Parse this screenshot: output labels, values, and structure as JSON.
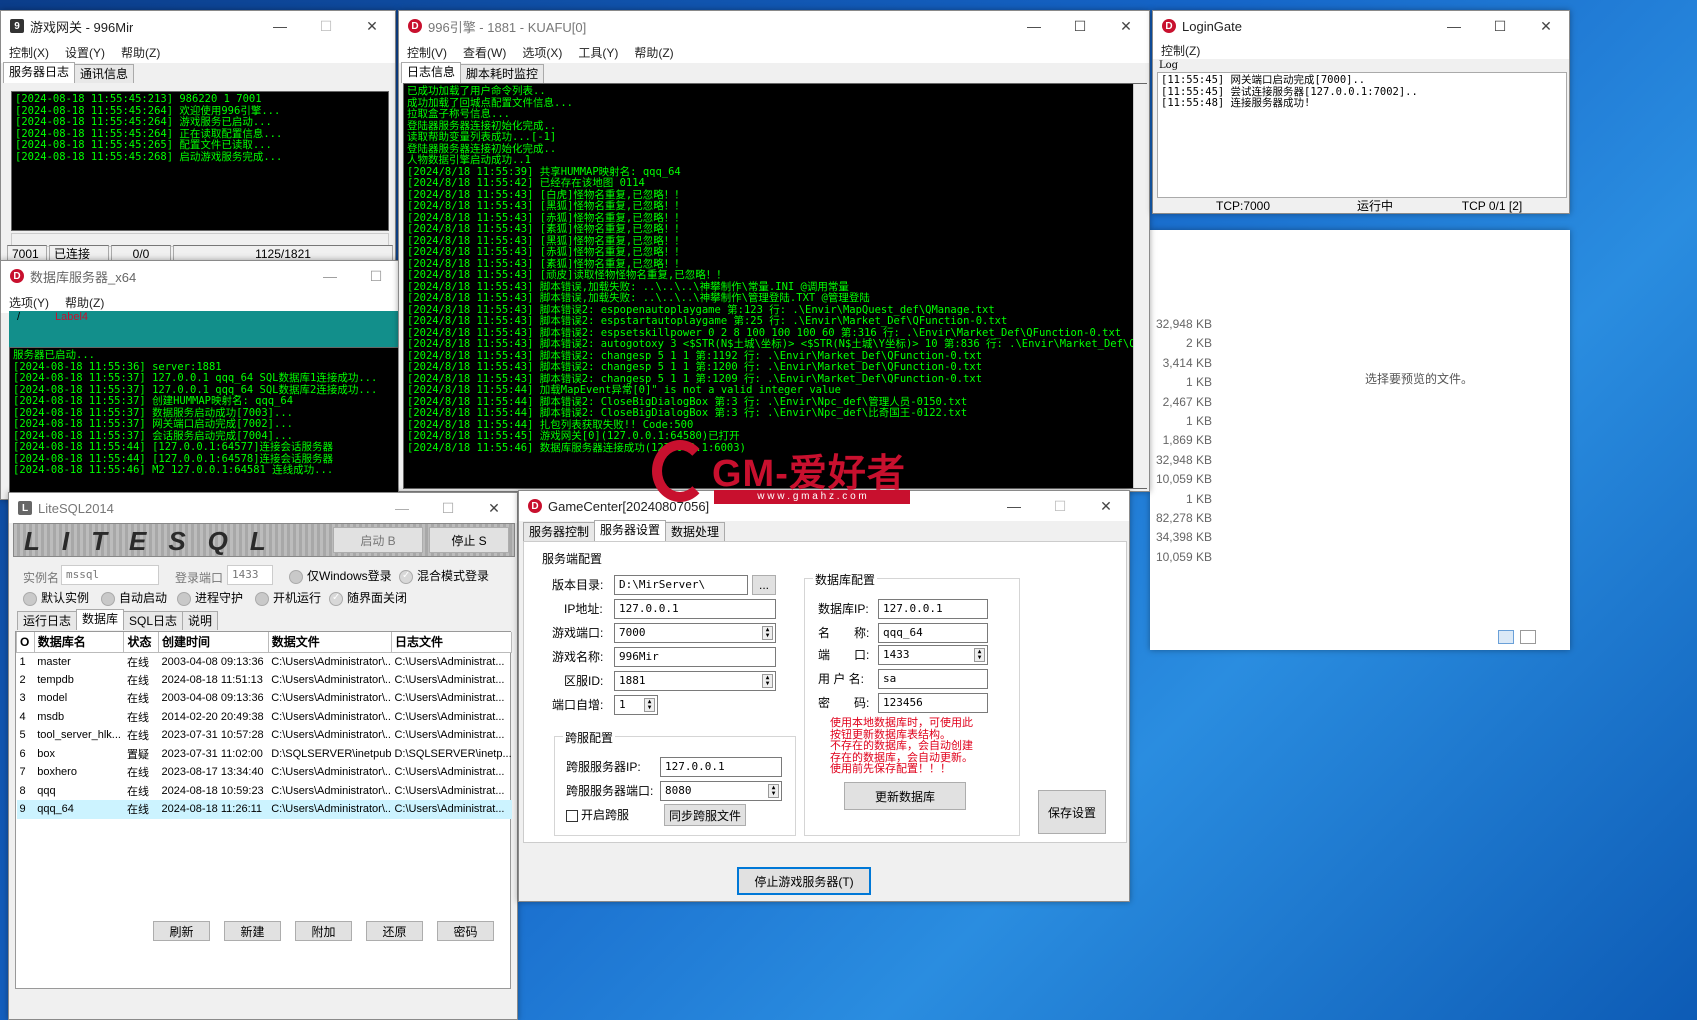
{
  "gateway": {
    "title": "游戏网关 - 996Mir",
    "menu": [
      "控制(X)",
      "设置(Y)",
      "帮助(Z)"
    ],
    "tabs": [
      "服务器日志",
      "通讯信息"
    ],
    "log": [
      "[2024-08-18 11:55:45:213] 986220 1 7001",
      "[2024-08-18 11:55:45:264] 欢迎使用996引擎...",
      "[2024-08-18 11:55:45:264] 游戏服务已启动...",
      "[2024-08-18 11:55:45:264] 正在读取配置信息...",
      "[2024-08-18 11:55:45:265] 配置文件已读取...",
      "[2024-08-18 11:55:45:268] 启动游戏服务完成..."
    ],
    "status": [
      "7001",
      "已连接",
      "0/0",
      "1125/1821"
    ]
  },
  "engine": {
    "title": "996引擎 - 1881 - KUAFU[0]",
    "menu": [
      "控制(V)",
      "查看(W)",
      "选项(X)",
      "工具(Y)",
      "帮助(Z)"
    ],
    "tabs": [
      "日志信息",
      "脚本耗时监控"
    ],
    "log": [
      "已成功加载了用户命令列表..",
      "成功加载了回城点配置文件信息...",
      "拉取盒子称号信息...",
      "登陆器服务器连接初始化完成..",
      "读取帮助变量列表成功...[-1]",
      "登陆器服务器连接初始化完成..",
      "人物数据引擎启动成功..1",
      "[2024/8/18 11:55:39] 共享HUMMAP映射名: qqq_64",
      "[2024/8/18 11:55:42] 已经存在该地图 0114",
      "[2024/8/18 11:55:43] [白虎]怪物名重复,已忽略！！",
      "[2024/8/18 11:55:43] [黑狐]怪物名重复,已忽略！！",
      "[2024/8/18 11:55:43] [赤狐]怪物名重复,已忽略！！",
      "[2024/8/18 11:55:43] [素狐]怪物名重复,已忽略！！",
      "[2024/8/18 11:55:43] [黑狐]怪物名重复,已忽略！！",
      "[2024/8/18 11:55:43] [赤狐]怪物名重复,已忽略！！",
      "[2024/8/18 11:55:43] [素狐]怪物名重复,已忽略！！",
      "[2024/8/18 11:55:43] [顽皮]读取怪物怪物名重复,已忽略！！",
      "[2024/8/18 11:55:43] 脚本错误,加载失败: ..\\..\\..\\神攀制作\\常量.INI  @调用常量",
      "[2024/8/18 11:55:43] 脚本错误,加载失败: ..\\..\\..\\神攀制作\\管理登陆.TXT  @管理登陆",
      "[2024/8/18 11:55:43] 脚本错误2: espopenautoplaygame 第:123 行: .\\Envir\\MapQuest_def\\QManage.txt",
      "[2024/8/18 11:55:43] 脚本错误2: espstartautoplaygame 第:25 行: .\\Envir\\Market_Def\\QFunction-0.txt",
      "[2024/8/18 11:55:43] 脚本错误2: espsetskillpower 0 2 8 100 100 100 60 第:316 行: .\\Envir\\Market_Def\\QFunction-0.txt",
      "[2024/8/18 11:55:43] 脚本错误2: autogotoxy 3 <$STR(N$土城\\坐标)> <$STR(N$土城\\Y坐标)> 10 第:836 行: .\\Envir\\Market_Def\\QFunction-0.txt",
      "[2024/8/18 11:55:43] 脚本错误2: changesp 5 1 1 第:1192 行: .\\Envir\\Market_Def\\QFunction-0.txt",
      "[2024/8/18 11:55:43] 脚本错误2: changesp 5 1 1 第:1200 行: .\\Envir\\Market_Def\\QFunction-0.txt",
      "[2024/8/18 11:55:43] 脚本错误2: changesp 5 1 1 第:1209 行: .\\Envir\\Market_Def\\QFunction-0.txt",
      "[2024/8/18 11:55:44] 加载MapEvent异常[0]\" is not a valid integer value",
      "[2024/8/18 11:55:44] 脚本错误2: CloseBigDialogBox 第:3 行: .\\Envir\\Npc_def\\管理人员-0150.txt",
      "[2024/8/18 11:55:44] 脚本错误2: CloseBigDialogBox 第:3 行: .\\Envir\\Npc_def\\比奇国王-0122.txt",
      "[2024/8/18 11:55:44] 扎包列表获取失败!! Code:500",
      "[2024/8/18 11:55:45] 游戏网关[0](127.0.0.1:64580)已打开",
      "[2024/8/18 11:55:46] 数据库服务器连接成功(127.0.0.1:6003)"
    ]
  },
  "logingate": {
    "title": "LoginGate",
    "menu": [
      "控制(Z)"
    ],
    "log_label": "Log",
    "log": [
      "[11:55:45] 网关端口启动完成[7000]..",
      "[11:55:45] 尝试连接服务器[127.0.0.1:7002]..",
      "[11:55:48] 连接服务器成功!"
    ],
    "status": [
      "TCP:7000",
      "运行中",
      "TCP 0/1 [2]"
    ]
  },
  "dbserver": {
    "title": "数据库服务器_x64",
    "menu": [
      "选项(Y)",
      "帮助(Z)"
    ],
    "banner_slash": "/",
    "banner_label": "Label4",
    "log": [
      "服务器已启动...",
      "[2024-08-18 11:55:36] server:1881",
      "[2024-08-18 11:55:37] 127.0.0.1 qqq_64 SQL数据库1连接成功...",
      "[2024-08-18 11:55:37] 127.0.0.1 qqq_64 SQL数据库2连接成功...",
      "[2024-08-18 11:55:37] 创建HUMMAP映射名: qqq_64",
      "[2024-08-18 11:55:37] 数据服务启动成功[7003]...",
      "[2024-08-18 11:55:37] 网关端口启动完成[7002]...",
      "[2024-08-18 11:55:37] 会话服务启动完成[7004]...",
      "[2024-08-18 11:55:44] [127.0.0.1:64577]连接会话服务器",
      "[2024-08-18 11:55:44] [127.0.0.1:64578]连接会话服务器",
      "[2024-08-18 11:55:46] M2 127.0.0.1:64581 连线成功..."
    ]
  },
  "litesql": {
    "title": "LiteSQL2014",
    "logo": "LITESQL",
    "btn_start": "启动 B",
    "btn_stop": "停止 S",
    "instance_label": "实例名",
    "instance": "mssql",
    "port_label": "登录端口",
    "port": "1433",
    "opts": [
      "仅Windows登录",
      "混合模式登录",
      "默认实例",
      "自动启动",
      "进程守护",
      "开机运行",
      "随界面关闭"
    ],
    "tabs": [
      "运行日志",
      "数据库",
      "SQL日志",
      "说明"
    ],
    "columns": [
      "O",
      "数据库名",
      "状态",
      "创建时间",
      "数据文件",
      "日志文件"
    ],
    "rows": [
      [
        "1",
        "master",
        "在线",
        "2003-04-08 09:13:36",
        "C:\\Users\\Administrator\\...",
        "C:\\Users\\Administrat..."
      ],
      [
        "2",
        "tempdb",
        "在线",
        "2024-08-18 11:51:13",
        "C:\\Users\\Administrator\\...",
        "C:\\Users\\Administrat..."
      ],
      [
        "3",
        "model",
        "在线",
        "2003-04-08 09:13:36",
        "C:\\Users\\Administrator\\...",
        "C:\\Users\\Administrat..."
      ],
      [
        "4",
        "msdb",
        "在线",
        "2014-02-20 20:49:38",
        "C:\\Users\\Administrator\\...",
        "C:\\Users\\Administrat..."
      ],
      [
        "5",
        "tool_server_hlk...",
        "在线",
        "2023-07-31 10:57:28",
        "C:\\Users\\Administrator\\...",
        "C:\\Users\\Administrat..."
      ],
      [
        "6",
        "box",
        "置疑",
        "2023-07-31 11:02:00",
        "D:\\SQLSERVER\\inetpub\\...",
        "D:\\SQLSERVER\\inetp..."
      ],
      [
        "7",
        "boxhero",
        "在线",
        "2023-08-17 13:34:40",
        "C:\\Users\\Administrator\\...",
        "C:\\Users\\Administrat..."
      ],
      [
        "8",
        "qqq",
        "在线",
        "2024-08-18 10:59:23",
        "C:\\Users\\Administrator\\...",
        "C:\\Users\\Administrat..."
      ],
      [
        "9",
        "qqq_64",
        "在线",
        "2024-08-18 11:26:11",
        "C:\\Users\\Administrator\\...",
        "C:\\Users\\Administrat..."
      ]
    ],
    "bottom": [
      "刷新",
      "新建",
      "附加",
      "还原",
      "密码"
    ]
  },
  "gamecenter": {
    "title": "GameCenter[20240807056]",
    "tabs": [
      "服务器控制",
      "服务器设置",
      "数据处理"
    ],
    "server_group": "服务端配置",
    "dir_label": "版本目录:",
    "dir": "D:\\MirServer\\",
    "browse": "...",
    "ip_label": "IP地址:",
    "ip": "127.0.0.1",
    "gport_label": "游戏端口:",
    "gport": "7000",
    "gname_label": "游戏名称:",
    "gname": "996Mir",
    "zone_label": "区服ID:",
    "zone": "1881",
    "inc_label": "端口自增:",
    "inc": "1",
    "cross_group": "跨服配置",
    "cip_label": "跨服服务器IP:",
    "cip": "127.0.0.1",
    "cport_label": "跨服服务器端口:",
    "cport": "8080",
    "cenable": "开启跨服",
    "csync": "同步跨服文件",
    "db_group": "数据库配置",
    "dbip_label": "数据库IP:",
    "dbip": "127.0.0.1",
    "dbname_label": "名　　称:",
    "dbname": "qqq_64",
    "dbport_label": "端　　口:",
    "dbport": "1433",
    "dbuser_label": "用 户 名:",
    "dbuser": "sa",
    "dbpass_label": "密　　码:",
    "dbpass": "123456",
    "note": [
      "使用本地数据库时，可使用此",
      "按钮更新数据库表结构。",
      "不存在的数据库，会自动创建",
      "存在的数据库，会自动更新。",
      "使用前先保存配置！！！"
    ],
    "update_btn": "更新数据库",
    "save_btn": "保存设置",
    "stop_btn": "停止游戏服务器(T)"
  },
  "explorer": {
    "sizes": [
      "32,948 KB",
      "2 KB",
      "3,414 KB",
      "1 KB",
      "2,467 KB",
      "1 KB",
      "1,869 KB",
      "32,948 KB",
      "10,059 KB",
      "1 KB",
      "82,278 KB",
      "34,398 KB",
      "10,059 KB"
    ],
    "preview": "选择要预览的文件。"
  },
  "watermark": {
    "brand": "GM-爱好者",
    "url": "w w w . g m a h z . c o m"
  },
  "colors": {
    "log_green": "#00ff00",
    "log_bg": "#000000",
    "teal": "#128f8b",
    "brand_red": "#c8102e"
  }
}
